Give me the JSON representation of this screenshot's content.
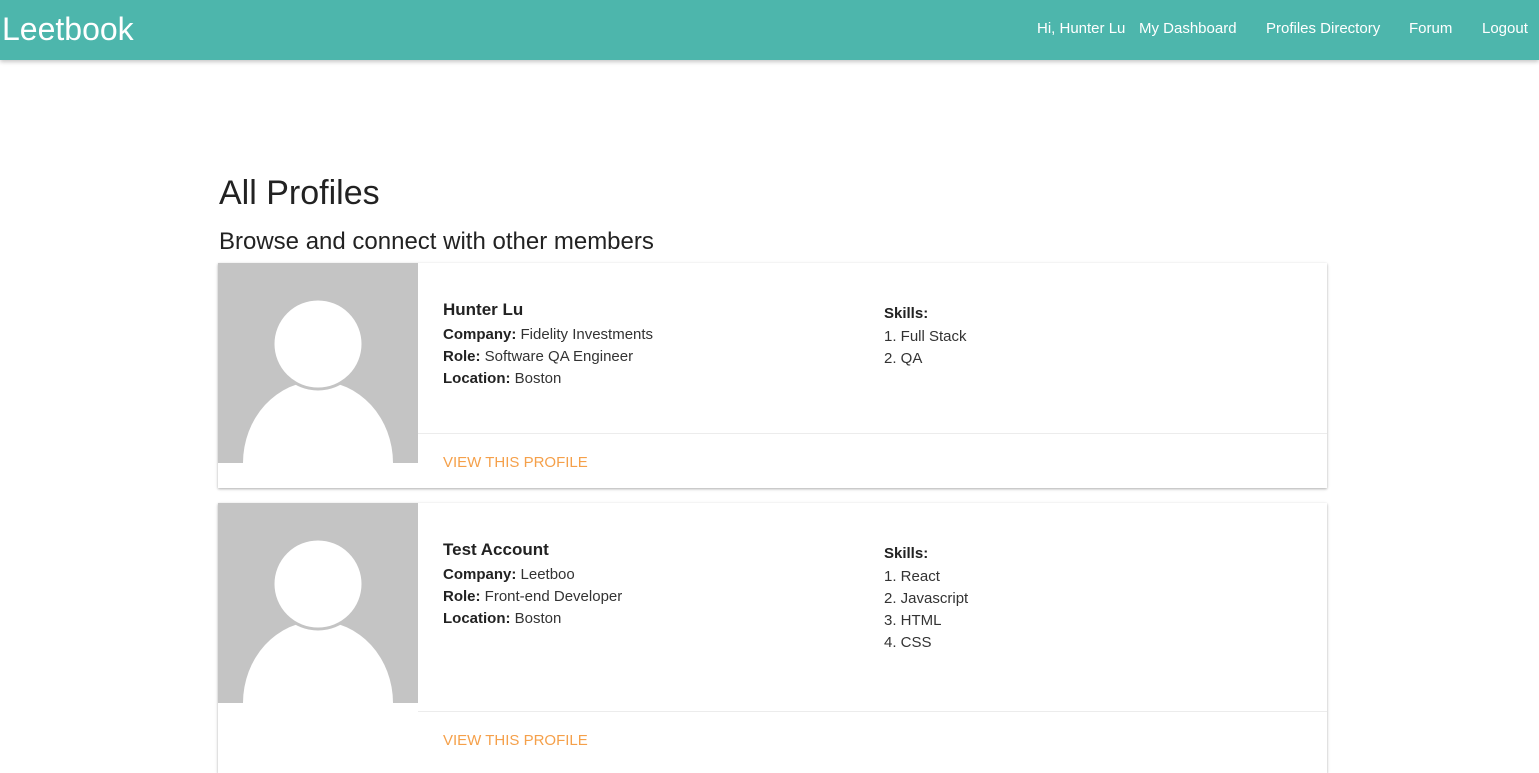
{
  "navbar": {
    "brand": "Leetbook",
    "greeting": "Hi, Hunter Lu",
    "links": {
      "dashboard": "My Dashboard",
      "directory": "Profiles Directory",
      "forum": "Forum",
      "logout": "Logout"
    }
  },
  "page": {
    "title": "All Profiles",
    "subtitle": "Browse and connect with other members"
  },
  "labels": {
    "company": "Company:",
    "role": "Role:",
    "location": "Location:",
    "skills": "Skills:",
    "view_profile": "VIEW THIS PROFILE"
  },
  "profiles": [
    {
      "name": "Hunter Lu",
      "company": "Fidelity Investments",
      "role": "Software QA Engineer",
      "location": "Boston",
      "skills": [
        "1. Full Stack",
        "2. QA"
      ]
    },
    {
      "name": "Test Account",
      "company": "Leetboo",
      "role": "Front-end Developer",
      "location": "Boston",
      "skills": [
        "1. React",
        "2. Javascript",
        "3. HTML",
        "4. CSS"
      ]
    }
  ],
  "colors": {
    "navbar": "#4db6ac",
    "link_accent": "#f5a04a",
    "avatar_bg": "#c4c4c4"
  }
}
